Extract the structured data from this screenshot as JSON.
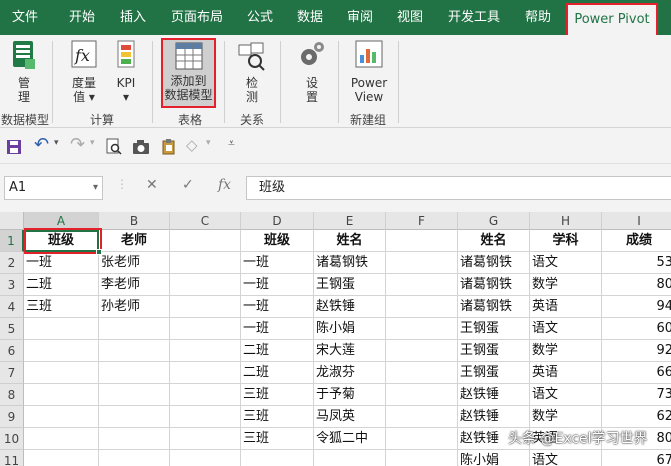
{
  "tabs": [
    "文件",
    "开始",
    "插入",
    "页面布局",
    "公式",
    "数据",
    "审阅",
    "视图",
    "开发工具",
    "帮助",
    "Power Pivot"
  ],
  "ribbon": {
    "manage": "管\n理",
    "measures": "度量\n值 ▾",
    "kpi": "KPI\n▾",
    "add_to_model": "添加到\n数据模型",
    "detect": "检\n测",
    "settings": "设\n置",
    "power_view": "Power\nView",
    "groups": [
      "数据模型",
      "计算",
      "表格",
      "关系",
      "新建组"
    ]
  },
  "formula_bar": {
    "name_box": "A1",
    "formula": "班级"
  },
  "columns": [
    "A",
    "B",
    "C",
    "D",
    "E",
    "F",
    "G",
    "H",
    "I"
  ],
  "rows": [
    "1",
    "2",
    "3",
    "4",
    "5",
    "6",
    "7",
    "8",
    "9",
    "10",
    "11"
  ],
  "cells": {
    "A": [
      "班级",
      "一班",
      "二班",
      "三班",
      "",
      "",
      "",
      "",
      "",
      "",
      ""
    ],
    "B": [
      "老师",
      "张老师",
      "李老师",
      "孙老师",
      "",
      "",
      "",
      "",
      "",
      "",
      ""
    ],
    "C": [
      "",
      "",
      "",
      "",
      "",
      "",
      "",
      "",
      "",
      "",
      ""
    ],
    "D": [
      "班级",
      "一班",
      "一班",
      "一班",
      "一班",
      "二班",
      "二班",
      "三班",
      "三班",
      "三班",
      ""
    ],
    "E": [
      "姓名",
      "诸葛钢铁",
      "王钢蛋",
      "赵铁锤",
      "陈小娟",
      "宋大莲",
      "龙淑芬",
      "于予菊",
      "马凤英",
      "令狐二中",
      ""
    ],
    "F": [
      "",
      "",
      "",
      "",
      "",
      "",
      "",
      "",
      "",
      "",
      ""
    ],
    "G": [
      "姓名",
      "诸葛钢铁",
      "诸葛钢铁",
      "诸葛钢铁",
      "王钢蛋",
      "王钢蛋",
      "王钢蛋",
      "赵铁锤",
      "赵铁锤",
      "赵铁锤",
      "陈小娟"
    ],
    "H": [
      "学科",
      "语文",
      "数学",
      "英语",
      "语文",
      "数学",
      "英语",
      "语文",
      "数学",
      "英语",
      "语文"
    ],
    "I": [
      "成绩",
      "53",
      "80",
      "94",
      "60",
      "92",
      "66",
      "73",
      "62",
      "80",
      "67"
    ]
  },
  "watermark": "头条 @Excel学习世界"
}
